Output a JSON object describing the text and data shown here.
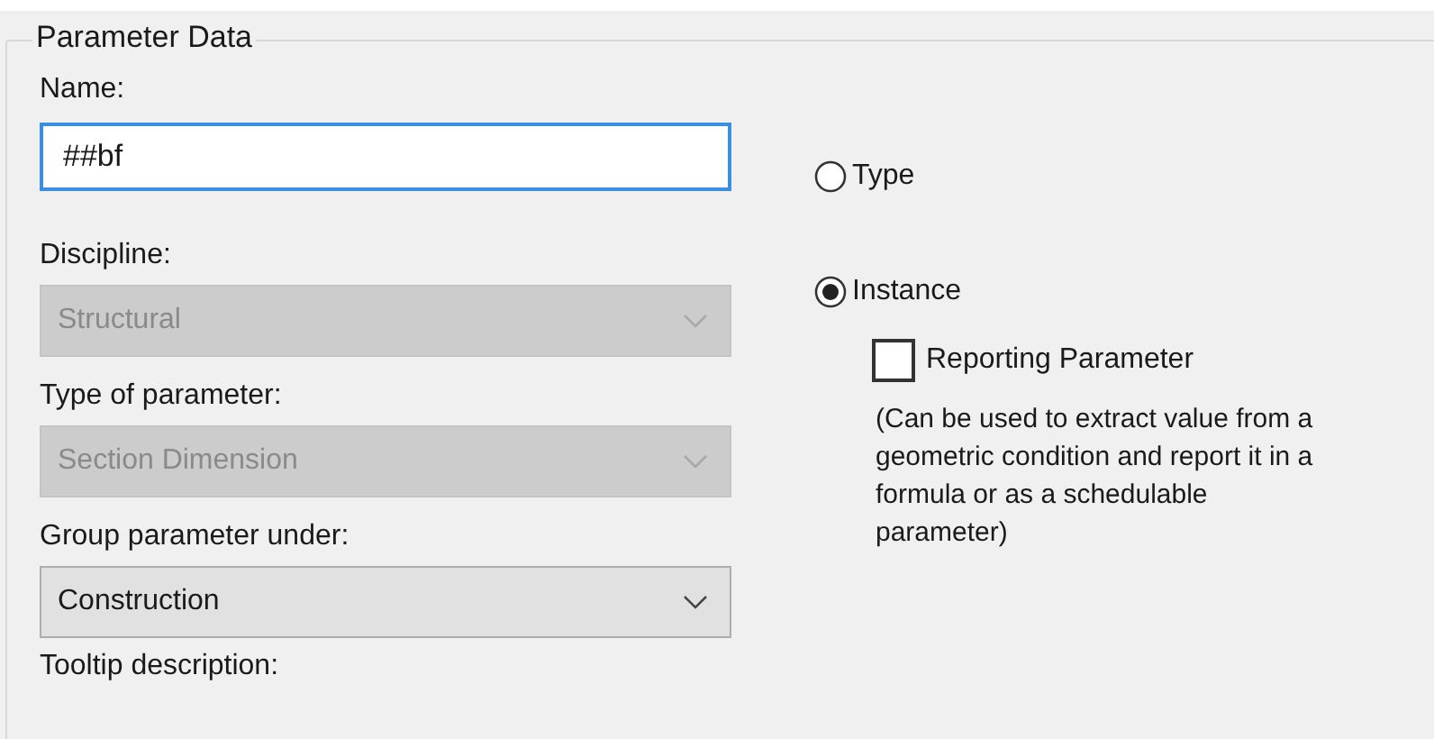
{
  "group_title": "Parameter Data",
  "name_field": {
    "label": "Name:",
    "value": "##bf",
    "focused": true
  },
  "dropdowns": [
    {
      "label": "Discipline:",
      "value": "Structural",
      "disabled": true
    },
    {
      "label": "Type of parameter:",
      "value": "Section Dimension",
      "disabled": true
    },
    {
      "label": "Group parameter under:",
      "value": "Construction",
      "disabled": false
    }
  ],
  "tooltip_label": "Tooltip description:",
  "radios": [
    {
      "label": "Type",
      "selected": false
    },
    {
      "label": "Instance",
      "selected": true
    }
  ],
  "reporting": {
    "label": "Reporting Parameter",
    "checked": false
  },
  "note": "(Can be used to extract value from a geometric condition and report it in a formula or as a schedulable parameter)"
}
